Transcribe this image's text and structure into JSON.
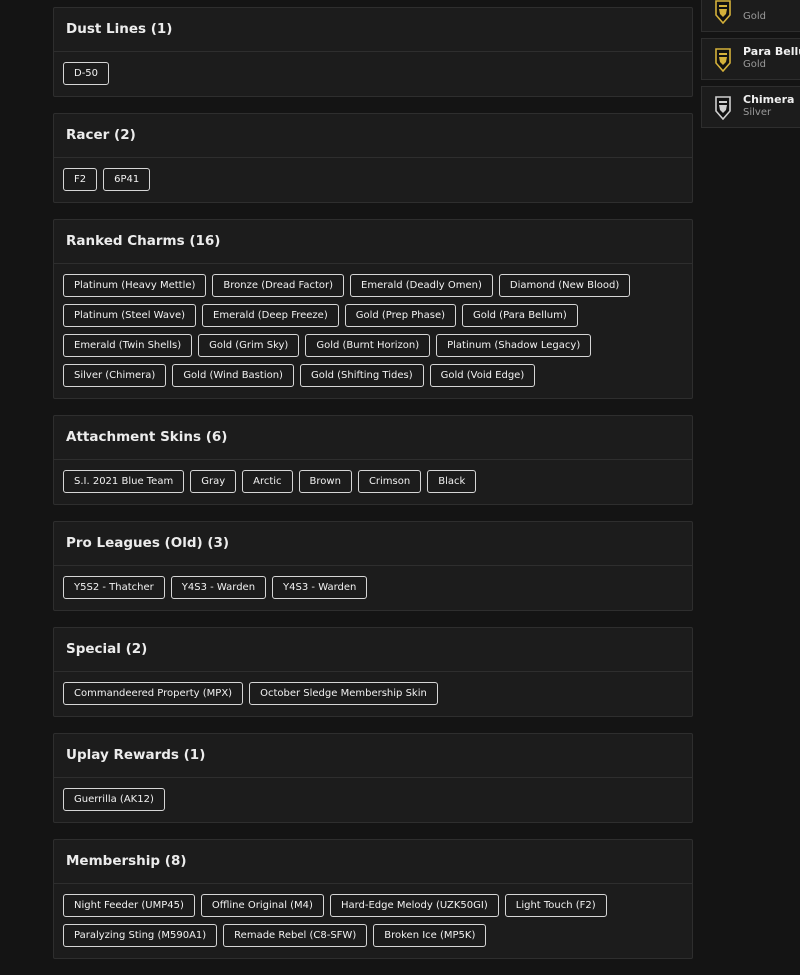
{
  "sections": [
    {
      "title": "Dust Lines (1)",
      "items": [
        "D-50"
      ]
    },
    {
      "title": "Racer (2)",
      "items": [
        "F2",
        "6P41"
      ]
    },
    {
      "title": "Ranked Charms (16)",
      "items": [
        "Platinum (Heavy Mettle)",
        "Bronze (Dread Factor)",
        "Emerald (Deadly Omen)",
        "Diamond (New Blood)",
        "Platinum (Steel Wave)",
        "Emerald (Deep Freeze)",
        "Gold (Prep Phase)",
        "Gold (Para Bellum)",
        "Emerald (Twin Shells)",
        "Gold (Grim Sky)",
        "Gold (Burnt Horizon)",
        "Platinum (Shadow Legacy)",
        "Silver (Chimera)",
        "Gold (Wind Bastion)",
        "Gold (Shifting Tides)",
        "Gold (Void Edge)"
      ]
    },
    {
      "title": "Attachment Skins (6)",
      "items": [
        "S.I. 2021 Blue Team",
        "Gray",
        "Arctic",
        "Brown",
        "Crimson",
        "Black"
      ]
    },
    {
      "title": "Pro Leagues (Old) (3)",
      "items": [
        "Y5S2 - Thatcher",
        "Y4S3 - Warden",
        "Y4S3 - Warden"
      ]
    },
    {
      "title": "Special (2)",
      "items": [
        "Commandeered Property (MPX)",
        "October Sledge Membership Skin"
      ]
    },
    {
      "title": "Uplay Rewards (1)",
      "items": [
        "Guerrilla (AK12)"
      ]
    },
    {
      "title": "Membership (8)",
      "items": [
        "Night Feeder (UMP45)",
        "Offline Original (M4)",
        "Hard-Edge Melody (UZK50GI)",
        "Light Touch (F2)",
        "Paralyzing Sting (M590A1)",
        "Remade Rebel (C8-SFW)",
        "Broken Ice (MP5K)"
      ]
    }
  ],
  "right_panel": [
    {
      "name": "",
      "tier": "Gold",
      "icon": "gold-rank-icon",
      "color": "#d4b13a"
    },
    {
      "name": "Para Bellum",
      "tier": "Gold",
      "icon": "gold-rank-icon",
      "color": "#d4b13a"
    },
    {
      "name": "Chimera",
      "tier": "Silver",
      "icon": "silver-rank-icon",
      "color": "#cfcfcf"
    }
  ]
}
